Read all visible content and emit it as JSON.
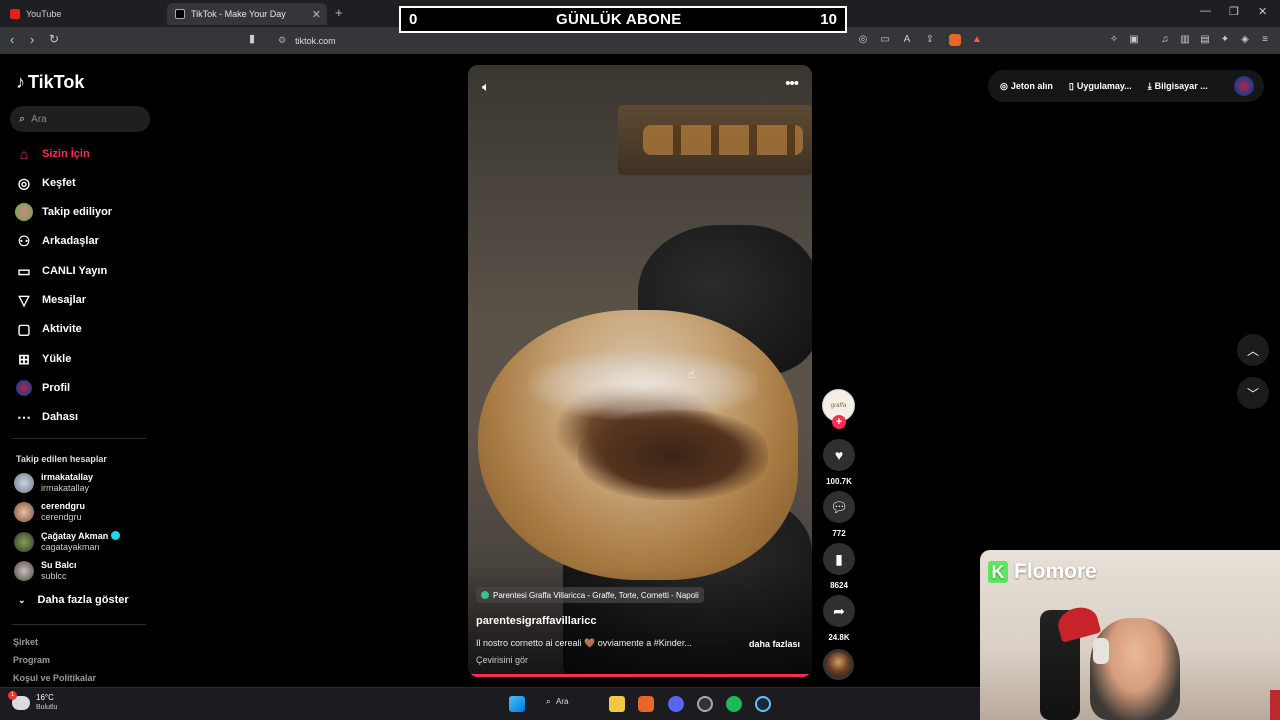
{
  "tabs": [
    {
      "label": "YouTube",
      "active": false
    },
    {
      "label": "TikTok - Make Your Day",
      "active": true
    }
  ],
  "overlay": {
    "left_value": "0",
    "title": "GÜNLÜK ABONE",
    "right_value": "10"
  },
  "address": {
    "url": "tiktok.com"
  },
  "brand": {
    "name": "TikTok"
  },
  "search": {
    "placeholder": "Ara"
  },
  "nav": [
    {
      "label": "Sizin İçin",
      "icon": "home-icon",
      "active": true
    },
    {
      "label": "Keşfet",
      "icon": "compass-icon"
    },
    {
      "label": "Takip ediliyor",
      "icon": "following-avatar-icon"
    },
    {
      "label": "Arkadaşlar",
      "icon": "friends-icon"
    },
    {
      "label": "CANLI Yayın",
      "icon": "live-icon"
    },
    {
      "label": "Mesajlar",
      "icon": "send-icon"
    },
    {
      "label": "Aktivite",
      "icon": "activity-icon"
    },
    {
      "label": "Yükle",
      "icon": "upload-icon"
    },
    {
      "label": "Profil",
      "icon": "profile-avatar-icon"
    },
    {
      "label": "Dahası",
      "icon": "more-icon"
    }
  ],
  "following": {
    "title": "Takip edilen hesaplar",
    "accounts": [
      {
        "name": "irmakatallay",
        "username": "irmakatallay"
      },
      {
        "name": "cerendgru",
        "username": "cerendgru"
      },
      {
        "name": "Çağatay Akman",
        "username": "cagatayakman",
        "verified": true
      },
      {
        "name": "Su Balcı",
        "username": "sublcc"
      }
    ],
    "show_more": "Daha fazla göster"
  },
  "footer": {
    "links": [
      "Şirket",
      "Program",
      "Koşul ve Politikalar"
    ]
  },
  "video": {
    "location": "Parentesi Graffa Villaricca - Graffe, Torte, Cornetti - Napoli",
    "author": "parentesigraffavillaricc",
    "caption": "Il nostro cornetto ai cereali 🤎 ovviamente a #Kinder...",
    "more": "daha fazlası",
    "translate": "Çevirisini gör",
    "likes": "100.7K",
    "comments": "772",
    "saves": "8624",
    "shares": "24.8K"
  },
  "top_actions": {
    "coins": "Jeton alın",
    "app": "Uygulamay...",
    "computer": "Bilgisayar ..."
  },
  "webcam": {
    "brand": "Flomore"
  },
  "taskbar": {
    "weather_temp": "16°C",
    "weather_cond": "Bulutlu",
    "search_label": "Ara"
  },
  "colors": {
    "accent": "#fe2c55",
    "background": "#000000",
    "chrome": "#35363a"
  }
}
